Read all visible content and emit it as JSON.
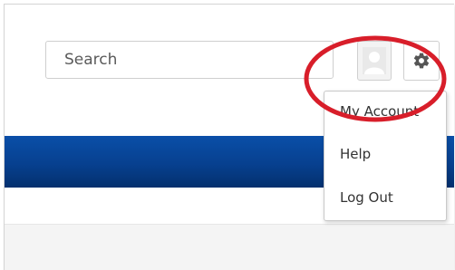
{
  "search": {
    "placeholder": "Search"
  },
  "header": {
    "avatar_icon": "user-avatar-icon",
    "settings_icon": "gear-icon"
  },
  "menu": {
    "items": [
      {
        "label": "My Account"
      },
      {
        "label": "Help"
      },
      {
        "label": "Log Out"
      }
    ]
  },
  "colors": {
    "brand_band": "#07408f",
    "annotation_circle": "#d81e2a"
  }
}
